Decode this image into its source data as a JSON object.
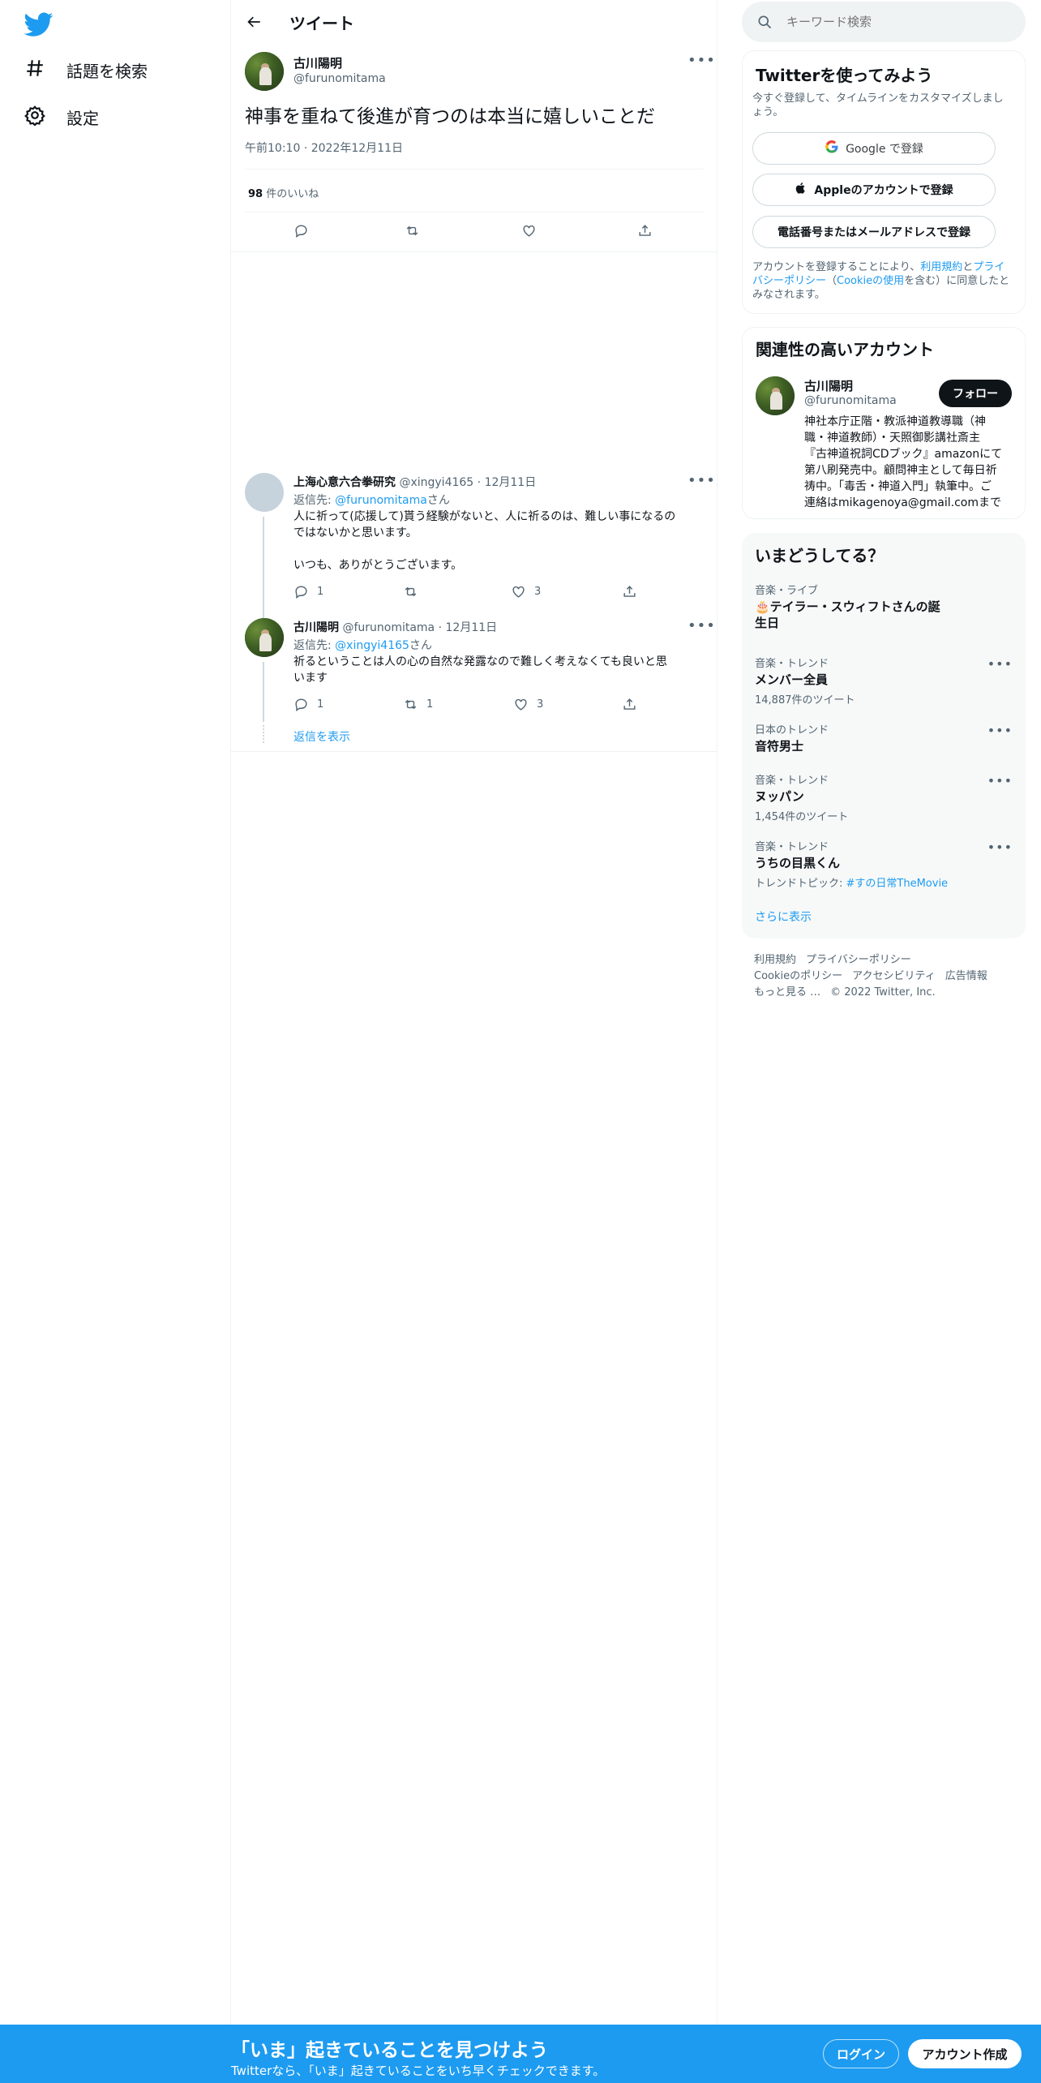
{
  "nav": {
    "logo_icon": "twitter-bird-icon",
    "items": [
      {
        "label": "話題を検索",
        "icon": "hashtag-icon"
      },
      {
        "label": "設定",
        "icon": "gear-icon"
      }
    ]
  },
  "header": {
    "title": "ツイート"
  },
  "tweet": {
    "author_name": "古川陽明",
    "author_handle": "@furunomitama",
    "text": "神事を重ねて後進が育つのは本当に嬉しいことだ",
    "time": "午前10:10",
    "date": "2022年12月11日",
    "likes_count": "98",
    "likes_label": "件のいいね"
  },
  "replies": [
    {
      "author_name": "上海心意六合拳研究",
      "author_handle": "@xingyi4165",
      "date": "12月11日",
      "reply_to_label": "返信先: ",
      "reply_to": "@furunomitama",
      "reply_to_suffix": "さん",
      "text_line1": "人に祈って(応援して)貰う経験がないと、人に祈るのは、難しい事になるの",
      "text_line2": "ではないかと思います。",
      "text_line3": "いつも、ありがとうございます。",
      "reply_count": "1",
      "retweet_count": "",
      "like_count": "3"
    },
    {
      "author_name": "古川陽明",
      "author_handle": "@furunomitama",
      "date": "12月11日",
      "reply_to_label": "返信先: ",
      "reply_to": "@xingyi4165",
      "reply_to_suffix": "さん",
      "text_line1": "祈るということは人の心の自然な発露なので難しく考えなくても良いと思",
      "text_line2": "います",
      "reply_count": "1",
      "retweet_count": "1",
      "like_count": "3"
    }
  ],
  "show_replies": "返信を表示",
  "search": {
    "placeholder": "キーワード検索"
  },
  "signup_card": {
    "title": "Twitterを使ってみよう",
    "subtitle_line1": "今すぐ登録して、タイムラインをカスタマイズしまし",
    "subtitle_line2": "ょう。",
    "google_btn": "Google で登録",
    "apple_btn": "Appleのアカウントで登録",
    "phone_btn": "電話番号またはメールアドレスで登録",
    "terms_prefix": "アカウントを登録することにより、",
    "terms_link": "利用規約",
    "terms_and": "と",
    "privacy_link_a": "プライ",
    "privacy_link_b": "バシーポリシー",
    "terms_paren_open": "（",
    "cookie_link": "Cookieの使用",
    "terms_suffix_a": "を含む）に同意したと",
    "terms_suffix_b": "みなされます。"
  },
  "related": {
    "title": "関連性の高いアカウント",
    "name": "古川陽明",
    "handle": "@furunomitama",
    "follow": "フォロー",
    "bio_lines": [
      "神社本庁正階・教派神道教導職（神",
      "職・神道教師）・天照御影講社斎主",
      "『古神道祝詞CDブック』amazonにて",
      "第八刷発売中。顧問神主として毎日祈",
      "祷中。「毒舌・神道入門」執筆中。ご",
      "連絡はmikagenoya@gmail.comまで"
    ]
  },
  "trends": {
    "title": "いまどうしてる？",
    "items": [
      {
        "category": "音楽・ライブ",
        "name_line1": "🎂テイラー・スウィフトさんの誕",
        "name_line2": "生日",
        "count": ""
      },
      {
        "category": "音楽・トレンド",
        "name_line1": "メンバー全員",
        "name_line2": "",
        "count": "14,887件のツイート"
      },
      {
        "category": "日本のトレンド",
        "name_line1": "音符男士",
        "name_line2": "",
        "count": ""
      },
      {
        "category": "音楽・トレンド",
        "name_line1": "ヌッパン",
        "name_line2": "",
        "count": "1,454件のツイート"
      },
      {
        "category": "音楽・トレンド",
        "name_line1": "うちの目黒くん",
        "name_line2": "",
        "count_prefix": "トレンドトピック: ",
        "count_link": "#すの日常TheMovie"
      }
    ],
    "show_more": "さらに表示"
  },
  "footer": {
    "terms": "利用規約",
    "privacy": "プライバシーポリシー",
    "cookie": "Cookieのポリシー",
    "accessibility": "アクセシビリティ",
    "ads": "広告情報",
    "more": "もっと見る …",
    "copyright": "© 2022 Twitter, Inc."
  },
  "bottom_bar": {
    "title": "「いま」起きていることを見つけよう",
    "subtitle": "Twitterなら、「いま」起きていることをいち早くチェックできます。",
    "login": "ログイン",
    "signup": "アカウント作成"
  },
  "colors": {
    "accent": "#1d9bf0",
    "text": "#0f1419",
    "muted": "#536471",
    "border": "#eff3f4"
  }
}
